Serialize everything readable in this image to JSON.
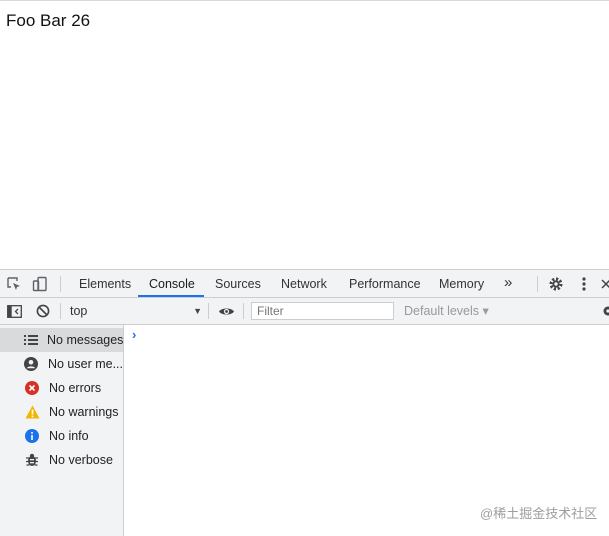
{
  "page": {
    "text": "Foo Bar 26"
  },
  "devtools": {
    "tabs": [
      {
        "label": "Elements"
      },
      {
        "label": "Console"
      },
      {
        "label": "Sources"
      },
      {
        "label": "Network"
      },
      {
        "label": "Performance"
      },
      {
        "label": "Memory"
      }
    ],
    "more_tabs": "»",
    "active_tab": "Console",
    "toolbar": {
      "context": "top",
      "filter_placeholder": "Filter",
      "levels": "Default levels ▾"
    },
    "sidebar": [
      {
        "label": "No messages",
        "icon": "list-icon"
      },
      {
        "label": "No user me...",
        "icon": "user-icon"
      },
      {
        "label": "No errors",
        "icon": "error-icon"
      },
      {
        "label": "No warnings",
        "icon": "warning-icon"
      },
      {
        "label": "No info",
        "icon": "info-icon"
      },
      {
        "label": "No verbose",
        "icon": "bug-icon"
      }
    ],
    "prompt": "›"
  },
  "watermark": "@稀土掘金技术社区",
  "colors": {
    "accent": "#1a73e8",
    "error": "#d93025",
    "warning": "#f2b600",
    "info": "#1a73e8"
  }
}
